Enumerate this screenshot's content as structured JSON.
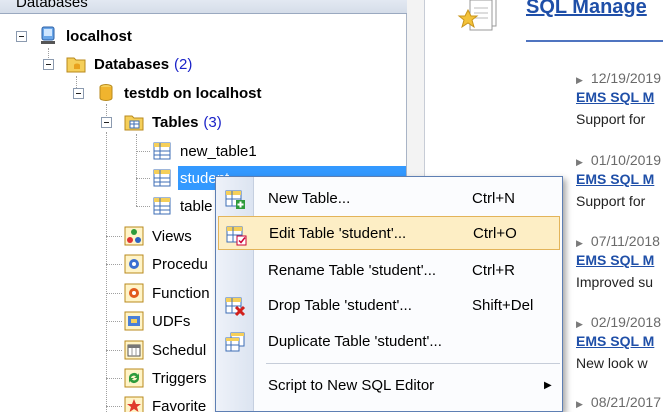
{
  "left_pane": {
    "header": "Databases",
    "tree": {
      "localhost": "localhost",
      "databases_label": "Databases",
      "databases_count": "(2)",
      "testdb": "testdb on localhost",
      "tables_label": "Tables",
      "tables_count": "(3)",
      "table1": "new_table1",
      "table2": "student",
      "table3": "table",
      "views": "Views",
      "procedures": "Procedu",
      "functions": "Function",
      "udfs": "UDFs",
      "scheduled": "Schedul",
      "triggers": "Triggers",
      "favorites": "Favorite"
    }
  },
  "right_pane": {
    "title": "SQL Manage",
    "news": [
      {
        "date": "12/19/2019",
        "link": "EMS SQL M",
        "text": "Support for"
      },
      {
        "date": "01/10/2019",
        "link": "EMS SQL M",
        "text": "Support for"
      },
      {
        "date": "07/11/2018",
        "link": "EMS SQL M",
        "text": "Improved su"
      },
      {
        "date": "02/19/2018",
        "link": "EMS SQL M",
        "text": "New look w"
      },
      {
        "date": "08/21/2017",
        "link": "",
        "text": ""
      }
    ]
  },
  "context_menu": {
    "items": [
      {
        "label": "New Table...",
        "shortcut": "Ctrl+N",
        "icon": "new-table-icon"
      },
      {
        "label": "Edit Table 'student'...",
        "shortcut": "Ctrl+O",
        "icon": "edit-table-icon"
      },
      {
        "label": "Rename Table 'student'...",
        "shortcut": "Ctrl+R",
        "icon": ""
      },
      {
        "label": "Drop Table 'student'...",
        "shortcut": "Shift+Del",
        "icon": "drop-table-icon"
      },
      {
        "label": "Duplicate Table 'student'...",
        "shortcut": "",
        "icon": "duplicate-table-icon"
      },
      {
        "label": "Script to New SQL Editor",
        "shortcut": "",
        "icon": ""
      }
    ],
    "highlighted_index": 1
  },
  "colors": {
    "selection": "#3399ff",
    "link": "#1f4fa8",
    "count": "#1a22c8",
    "menu_highlight": "#fdeec5"
  }
}
